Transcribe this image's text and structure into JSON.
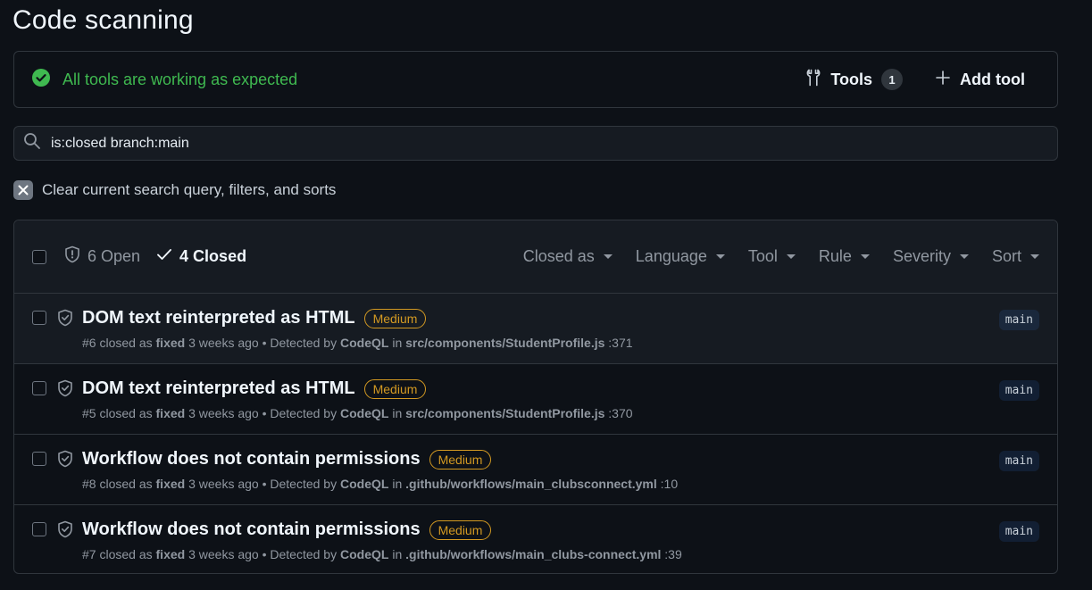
{
  "page_title": "Code scanning",
  "status": {
    "text": "All tools are working as expected",
    "color": "#3fb950",
    "icon": "check-circle-icon"
  },
  "tools": {
    "label": "Tools",
    "count": "1"
  },
  "add_tool": {
    "label": "Add tool"
  },
  "search": {
    "value": "is:closed branch:main"
  },
  "clear_query": {
    "label": "Clear current search query, filters, and sorts"
  },
  "list_header": {
    "open_label": "6 Open",
    "closed_label": "4 Closed",
    "filters": [
      "Closed as",
      "Language",
      "Tool",
      "Rule",
      "Severity",
      "Sort"
    ]
  },
  "alerts": [
    {
      "title": "DOM text reinterpreted as HTML",
      "severity": "Medium",
      "number": "#6",
      "closed_text": "closed as",
      "resolution": "fixed",
      "time": "3 weeks ago",
      "detected_text": "• Detected by",
      "tool": "CodeQL",
      "in_text": "in",
      "path": "src/components/StudentProfile.js",
      "line": ":371",
      "branch": "main"
    },
    {
      "title": "DOM text reinterpreted as HTML",
      "severity": "Medium",
      "number": "#5",
      "closed_text": "closed as",
      "resolution": "fixed",
      "time": "3 weeks ago",
      "detected_text": "• Detected by",
      "tool": "CodeQL",
      "in_text": "in",
      "path": "src/components/StudentProfile.js",
      "line": ":370",
      "branch": "main"
    },
    {
      "title": "Workflow does not contain permissions",
      "severity": "Medium",
      "number": "#8",
      "closed_text": "closed as",
      "resolution": "fixed",
      "time": "3 weeks ago",
      "detected_text": "• Detected by",
      "tool": "CodeQL",
      "in_text": "in",
      "path": ".github/workflows/main_clubsconnect.yml",
      "line": ":10",
      "branch": "main"
    },
    {
      "title": "Workflow does not contain permissions",
      "severity": "Medium",
      "number": "#7",
      "closed_text": "closed as",
      "resolution": "fixed",
      "time": "3 weeks ago",
      "detected_text": "• Detected by",
      "tool": "CodeQL",
      "in_text": "in",
      "path": ".github/workflows/main_clubs-connect.yml",
      "line": ":39",
      "branch": "main"
    }
  ]
}
